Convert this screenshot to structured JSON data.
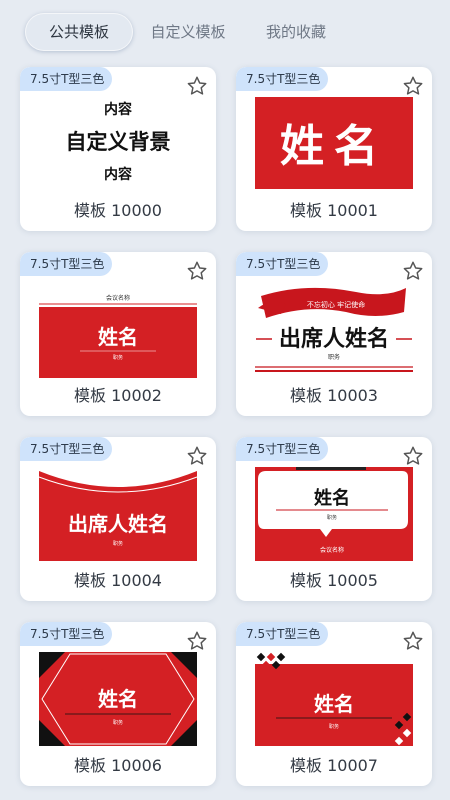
{
  "tabs": [
    {
      "label": "公共模板",
      "active": true
    },
    {
      "label": "自定义模板",
      "active": false
    },
    {
      "label": "我的收藏",
      "active": false
    }
  ],
  "badge_text": "7.5寸T型三色",
  "templates": [
    {
      "title": "模板 10000",
      "thumb": {
        "top_text": "内容",
        "main_text": "自定义背景",
        "bottom_text": "内容"
      }
    },
    {
      "title": "模板 10001",
      "thumb": {
        "main_text": "姓名"
      }
    },
    {
      "title": "模板 10002",
      "thumb": {
        "top_text": "会议名称",
        "main_text": "姓名",
        "sub_text": "职务"
      }
    },
    {
      "title": "模板 10003",
      "thumb": {
        "banner_text": "不忘初心 牢记使命",
        "main_text": "出席人姓名",
        "sub_text": "职务"
      }
    },
    {
      "title": "模板 10004",
      "thumb": {
        "main_text": "出席人姓名",
        "sub_text": "职务"
      }
    },
    {
      "title": "模板 10005",
      "thumb": {
        "main_text": "姓名",
        "sub_text": "职务",
        "bottom_text": "会议名称"
      }
    },
    {
      "title": "模板 10006",
      "thumb": {
        "main_text": "姓名",
        "sub_text": "职务"
      }
    },
    {
      "title": "模板 10007",
      "thumb": {
        "main_text": "姓名",
        "sub_text": "职务"
      }
    }
  ],
  "colors": {
    "red": "#d42024",
    "dark_red": "#b5121b",
    "badge_bg": "#cfe3fb",
    "active_tab_bg": "#e3e9f1"
  }
}
